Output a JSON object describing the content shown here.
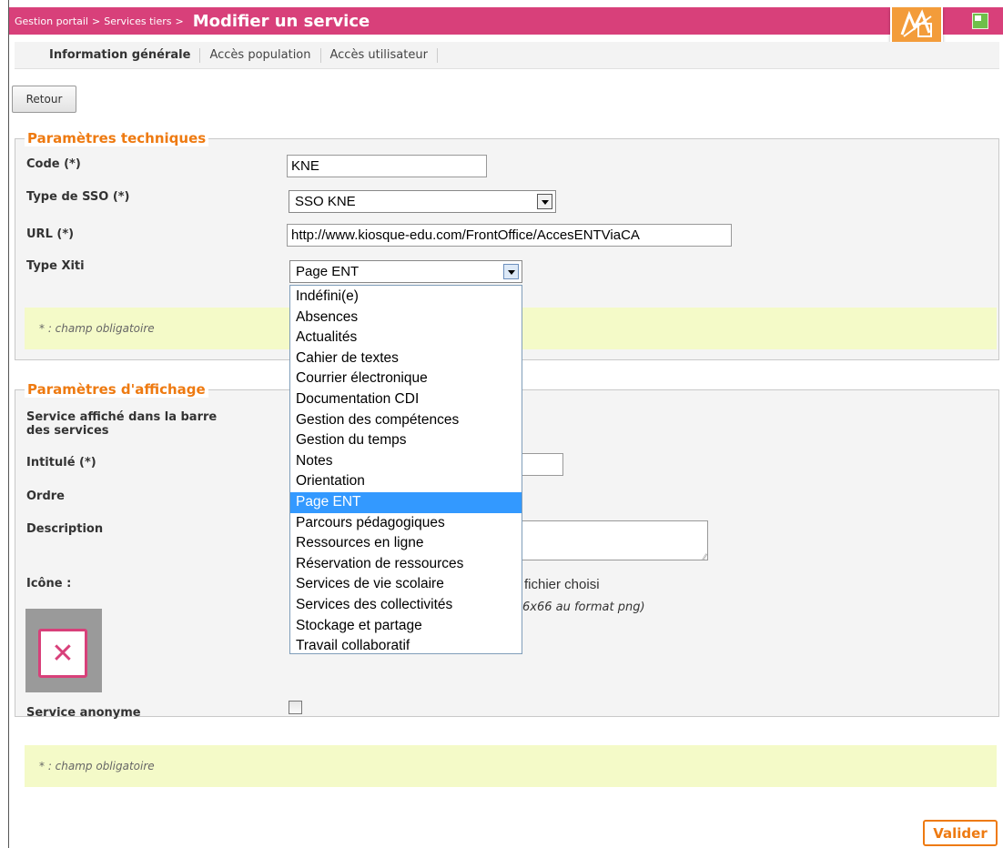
{
  "header": {
    "breadcrumb": [
      "Gestion portail",
      "Services tiers"
    ],
    "separator": ">",
    "title": "Modifier un service",
    "colors": {
      "header_bg": "#d8407a",
      "accent_orange": "#ee7a11"
    },
    "icons": [
      "edit-service-icon",
      "restore-window-icon"
    ]
  },
  "tabs": [
    {
      "label": "Information générale",
      "active": true
    },
    {
      "label": "Accès population",
      "active": false
    },
    {
      "label": "Accès utilisateur",
      "active": false
    }
  ],
  "buttons": {
    "back": "Retour",
    "submit": "Valider"
  },
  "technical": {
    "legend": "Paramètres techniques",
    "code_label": "Code (*)",
    "code_value": "KNE",
    "sso_label": "Type de SSO (*)",
    "sso_value": "SSO KNE",
    "url_label": "URL (*)",
    "url_value": "http://www.kiosque-edu.com/FrontOffice/AccesENTViaCA",
    "xiti_label": "Type Xiti",
    "xiti_value": "Page ENT",
    "xiti_options": [
      "Indéfini(e)",
      "Absences",
      "Actualités",
      "Cahier de textes",
      "Courrier électronique",
      "Documentation CDI",
      "Gestion des compétences",
      "Gestion du temps",
      "Notes",
      "Orientation",
      "Page ENT",
      "Parcours pédagogiques",
      "Ressources en ligne",
      "Réservation de ressources",
      "Services de vie scolaire",
      "Services des collectivités",
      "Stockage et partage",
      "Travail collaboratif"
    ],
    "note": "* : champ obligatoire"
  },
  "display": {
    "legend": "Paramètres d'affichage",
    "bar_label_line1": "Service affiché dans la barre",
    "bar_label_line2": "des services",
    "title_label": "Intitulé (*)",
    "order_label": "Ordre",
    "description_label": "Description",
    "icon_label": "Icône :",
    "file_status": "fichier choisi",
    "icon_hint": "6x66 au format png)",
    "anonymous_label": "Service anonyme",
    "anonymous_checked": false,
    "note": "* : champ obligatoire"
  }
}
